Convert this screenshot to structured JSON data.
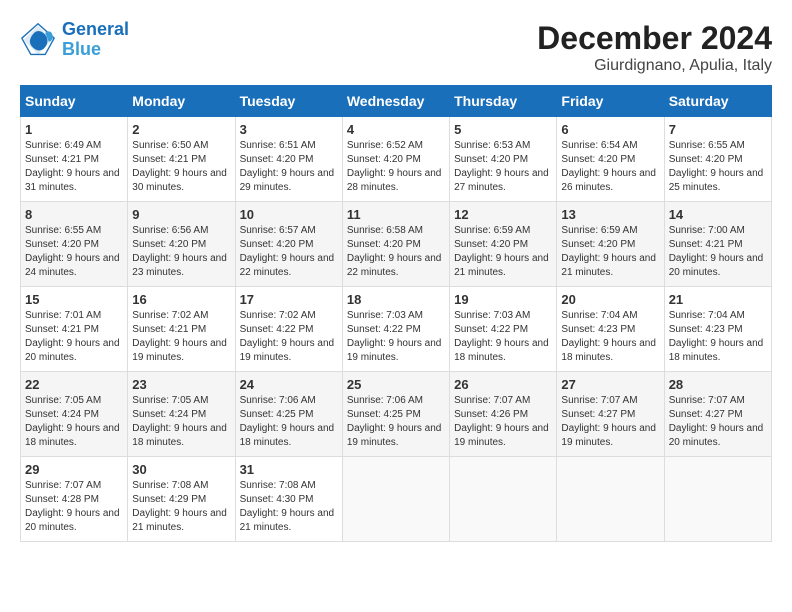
{
  "header": {
    "logo_line1": "General",
    "logo_line2": "Blue",
    "month": "December 2024",
    "location": "Giurdignano, Apulia, Italy"
  },
  "weekdays": [
    "Sunday",
    "Monday",
    "Tuesday",
    "Wednesday",
    "Thursday",
    "Friday",
    "Saturday"
  ],
  "weeks": [
    [
      {
        "day": "1",
        "sunrise": "6:49 AM",
        "sunset": "4:21 PM",
        "daylight": "9 hours and 31 minutes."
      },
      {
        "day": "2",
        "sunrise": "6:50 AM",
        "sunset": "4:21 PM",
        "daylight": "9 hours and 30 minutes."
      },
      {
        "day": "3",
        "sunrise": "6:51 AM",
        "sunset": "4:20 PM",
        "daylight": "9 hours and 29 minutes."
      },
      {
        "day": "4",
        "sunrise": "6:52 AM",
        "sunset": "4:20 PM",
        "daylight": "9 hours and 28 minutes."
      },
      {
        "day": "5",
        "sunrise": "6:53 AM",
        "sunset": "4:20 PM",
        "daylight": "9 hours and 27 minutes."
      },
      {
        "day": "6",
        "sunrise": "6:54 AM",
        "sunset": "4:20 PM",
        "daylight": "9 hours and 26 minutes."
      },
      {
        "day": "7",
        "sunrise": "6:55 AM",
        "sunset": "4:20 PM",
        "daylight": "9 hours and 25 minutes."
      }
    ],
    [
      {
        "day": "8",
        "sunrise": "6:55 AM",
        "sunset": "4:20 PM",
        "daylight": "9 hours and 24 minutes."
      },
      {
        "day": "9",
        "sunrise": "6:56 AM",
        "sunset": "4:20 PM",
        "daylight": "9 hours and 23 minutes."
      },
      {
        "day": "10",
        "sunrise": "6:57 AM",
        "sunset": "4:20 PM",
        "daylight": "9 hours and 22 minutes."
      },
      {
        "day": "11",
        "sunrise": "6:58 AM",
        "sunset": "4:20 PM",
        "daylight": "9 hours and 22 minutes."
      },
      {
        "day": "12",
        "sunrise": "6:59 AM",
        "sunset": "4:20 PM",
        "daylight": "9 hours and 21 minutes."
      },
      {
        "day": "13",
        "sunrise": "6:59 AM",
        "sunset": "4:20 PM",
        "daylight": "9 hours and 21 minutes."
      },
      {
        "day": "14",
        "sunrise": "7:00 AM",
        "sunset": "4:21 PM",
        "daylight": "9 hours and 20 minutes."
      }
    ],
    [
      {
        "day": "15",
        "sunrise": "7:01 AM",
        "sunset": "4:21 PM",
        "daylight": "9 hours and 20 minutes."
      },
      {
        "day": "16",
        "sunrise": "7:02 AM",
        "sunset": "4:21 PM",
        "daylight": "9 hours and 19 minutes."
      },
      {
        "day": "17",
        "sunrise": "7:02 AM",
        "sunset": "4:22 PM",
        "daylight": "9 hours and 19 minutes."
      },
      {
        "day": "18",
        "sunrise": "7:03 AM",
        "sunset": "4:22 PM",
        "daylight": "9 hours and 19 minutes."
      },
      {
        "day": "19",
        "sunrise": "7:03 AM",
        "sunset": "4:22 PM",
        "daylight": "9 hours and 18 minutes."
      },
      {
        "day": "20",
        "sunrise": "7:04 AM",
        "sunset": "4:23 PM",
        "daylight": "9 hours and 18 minutes."
      },
      {
        "day": "21",
        "sunrise": "7:04 AM",
        "sunset": "4:23 PM",
        "daylight": "9 hours and 18 minutes."
      }
    ],
    [
      {
        "day": "22",
        "sunrise": "7:05 AM",
        "sunset": "4:24 PM",
        "daylight": "9 hours and 18 minutes."
      },
      {
        "day": "23",
        "sunrise": "7:05 AM",
        "sunset": "4:24 PM",
        "daylight": "9 hours and 18 minutes."
      },
      {
        "day": "24",
        "sunrise": "7:06 AM",
        "sunset": "4:25 PM",
        "daylight": "9 hours and 18 minutes."
      },
      {
        "day": "25",
        "sunrise": "7:06 AM",
        "sunset": "4:25 PM",
        "daylight": "9 hours and 19 minutes."
      },
      {
        "day": "26",
        "sunrise": "7:07 AM",
        "sunset": "4:26 PM",
        "daylight": "9 hours and 19 minutes."
      },
      {
        "day": "27",
        "sunrise": "7:07 AM",
        "sunset": "4:27 PM",
        "daylight": "9 hours and 19 minutes."
      },
      {
        "day": "28",
        "sunrise": "7:07 AM",
        "sunset": "4:27 PM",
        "daylight": "9 hours and 20 minutes."
      }
    ],
    [
      {
        "day": "29",
        "sunrise": "7:07 AM",
        "sunset": "4:28 PM",
        "daylight": "9 hours and 20 minutes."
      },
      {
        "day": "30",
        "sunrise": "7:08 AM",
        "sunset": "4:29 PM",
        "daylight": "9 hours and 21 minutes."
      },
      {
        "day": "31",
        "sunrise": "7:08 AM",
        "sunset": "4:30 PM",
        "daylight": "9 hours and 21 minutes."
      },
      null,
      null,
      null,
      null
    ]
  ]
}
